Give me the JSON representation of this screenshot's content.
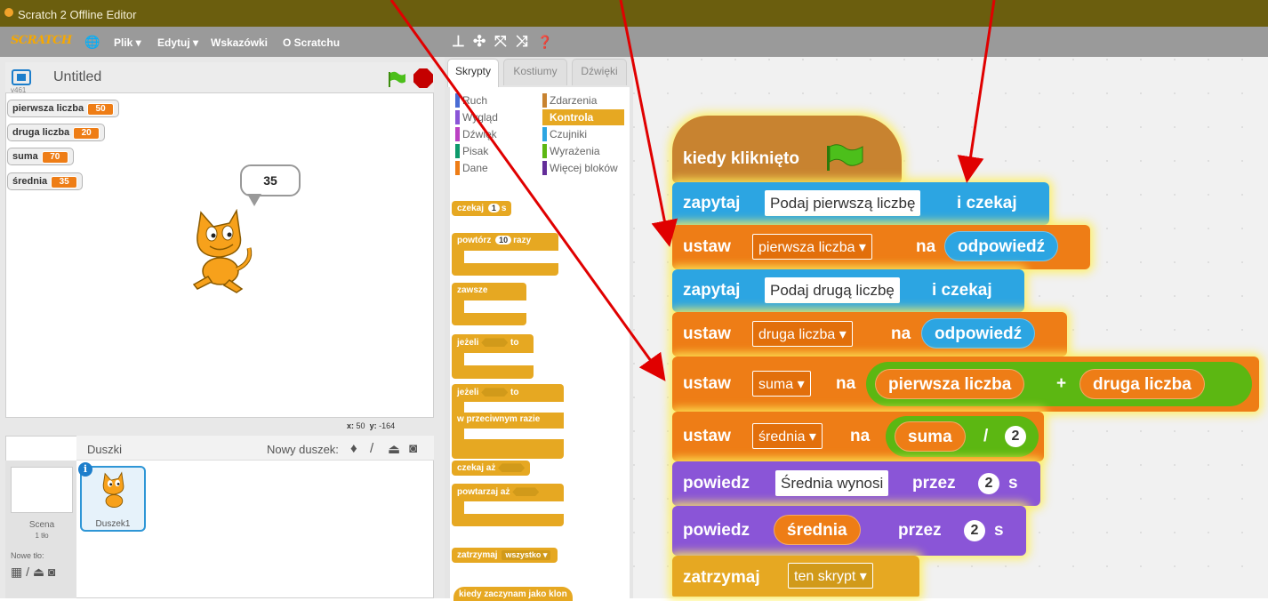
{
  "app": {
    "window_title": "Scratch 2 Offline Editor",
    "logo_text": "SCRATCH"
  },
  "menu": {
    "file": "Plik ▾",
    "edit": "Edytuj ▾",
    "tips": "Wskazówki",
    "about": "O Scratchu"
  },
  "toolbar": {
    "duplicate": "⊥",
    "delete": "✣",
    "grow": "⤧",
    "shrink": "⤨",
    "help": "❓"
  },
  "stage": {
    "project_title": "Untitled",
    "version": "v461",
    "monitors": [
      {
        "label": "pierwsza liczba",
        "value": "50"
      },
      {
        "label": "druga liczba",
        "value": "20"
      },
      {
        "label": "suma",
        "value": "70"
      },
      {
        "label": "średnia",
        "value": "35"
      }
    ],
    "speech": "35",
    "coords": {
      "x_label": "x:",
      "x": "50",
      "y_label": "y:",
      "y": "-164"
    }
  },
  "sprites": {
    "title": "Duszki",
    "new_sprite": "Nowy duszek:",
    "stage_label": "Scena",
    "stage_sub": "1 tło",
    "new_bg": "Nowe tło:",
    "sprite_name": "Duszek1"
  },
  "tabs": [
    "Skrypty",
    "Kostiumy",
    "Dźwięki"
  ],
  "categories": [
    {
      "label": "Ruch",
      "color": "#4a6cd4"
    },
    {
      "label": "Zdarzenia",
      "color": "#c88330"
    },
    {
      "label": "Wygląd",
      "color": "#8a55d7"
    },
    {
      "label": "Kontrola",
      "color": "#e6a822"
    },
    {
      "label": "Dźwięk",
      "color": "#bb42c3"
    },
    {
      "label": "Czujniki",
      "color": "#2ca5e2"
    },
    {
      "label": "Pisak",
      "color": "#0e9a6c"
    },
    {
      "label": "Wyrażenia",
      "color": "#5cb712"
    },
    {
      "label": "Dane",
      "color": "#ee7d16"
    },
    {
      "label": "Więcej bloków",
      "color": "#632d99"
    }
  ],
  "palette": {
    "wait": "czekaj",
    "wait_n": "1",
    "wait_s": "s",
    "repeat": "powtórz",
    "repeat_n": "10",
    "repeat_times": "razy",
    "forever": "zawsze",
    "if": "jeżeli",
    "then": "to",
    "if2": "jeżeli",
    "then2": "to",
    "else": "w przeciwnym razie",
    "wait_until": "czekaj aż",
    "repeat_until": "powtarzaj aż",
    "stop": "zatrzymaj",
    "stop_opt": "wszystko ▾",
    "clone_start": "kiedy zaczynam jako klon"
  },
  "script": {
    "hat": "kiedy kliknięto",
    "ask1": {
      "cmd": "zapytaj",
      "text": "Podaj pierwszą liczbę",
      "tail": "i czekaj"
    },
    "set1": {
      "cmd": "ustaw",
      "var": "pierwsza liczba ▾",
      "to": "na",
      "val": "odpowiedź"
    },
    "ask2": {
      "cmd": "zapytaj",
      "text": "Podaj drugą liczbę",
      "tail": "i czekaj"
    },
    "set2": {
      "cmd": "ustaw",
      "var": "druga liczba ▾",
      "to": "na",
      "val": "odpowiedź"
    },
    "set3": {
      "cmd": "ustaw",
      "var": "suma ▾",
      "to": "na",
      "a": "pierwsza liczba",
      "op": "+",
      "b": "druga liczba"
    },
    "set4": {
      "cmd": "ustaw",
      "var": "średnia ▾",
      "to": "na",
      "a": "suma",
      "op": "/",
      "b": "2"
    },
    "say1": {
      "cmd": "powiedz",
      "text": "Średnia wynosi",
      "for": "przez",
      "n": "2",
      "s": "s"
    },
    "say2": {
      "cmd": "powiedz",
      "val": "średnia",
      "for": "przez",
      "n": "2",
      "s": "s"
    },
    "stop": {
      "cmd": "zatrzymaj",
      "opt": "ten skrypt ▾"
    }
  }
}
